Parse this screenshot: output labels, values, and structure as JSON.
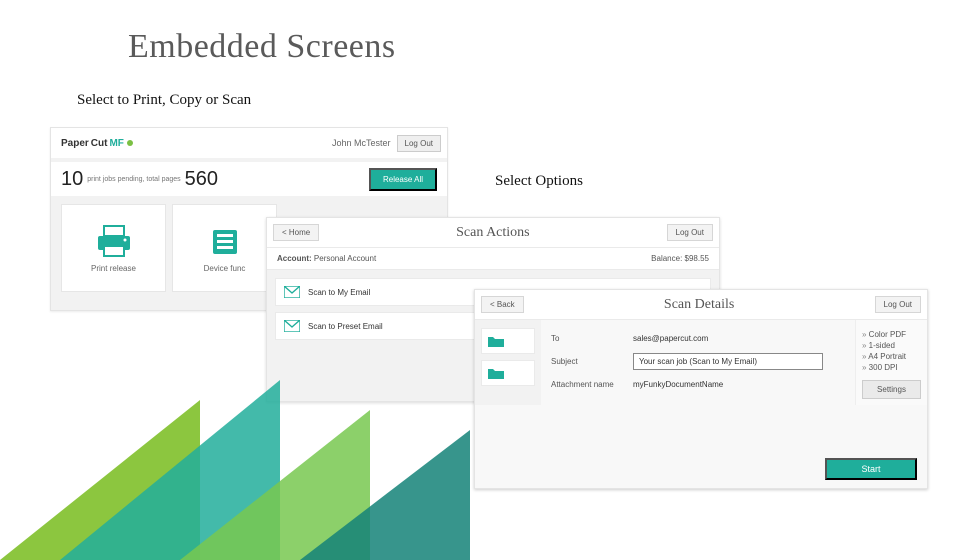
{
  "slide": {
    "title": "Embedded Screens",
    "caption1": "Select to Print, Copy or Scan",
    "caption2": "Select Options"
  },
  "panelA": {
    "logo_prefix": "Paper",
    "logo_mid": "Cut",
    "logo_suffix": "MF",
    "user": "John McTester",
    "logout": "Log Out",
    "jobs_count": "10",
    "jobs_label": "print jobs pending, total pages",
    "pages_count": "560",
    "release_all": "Release All",
    "card1": "Print release",
    "card2": "Device func"
  },
  "panelB": {
    "home": "< Home",
    "title": "Scan Actions",
    "logout": "Log Out",
    "account_k": "Account:",
    "account_v": "Personal Account",
    "balance_k": "Balance:",
    "balance_v": "$98.55",
    "row1": "Scan to My Email",
    "row2": "Scan to Preset Email"
  },
  "panelC": {
    "back": "< Back",
    "title": "Scan Details",
    "logout": "Log Out",
    "to_k": "To",
    "to_v": "sales@papercut.com",
    "subject_k": "Subject",
    "subject_v": "Your scan job (Scan to My Email)",
    "attach_k": "Attachment name",
    "attach_v": "myFunkyDocumentName",
    "opts": [
      "Color PDF",
      "1-sided",
      "A4 Portrait",
      "300 DPI"
    ],
    "settings": "Settings",
    "start": "Start"
  },
  "colors": {
    "accent": "#1fae9b"
  }
}
